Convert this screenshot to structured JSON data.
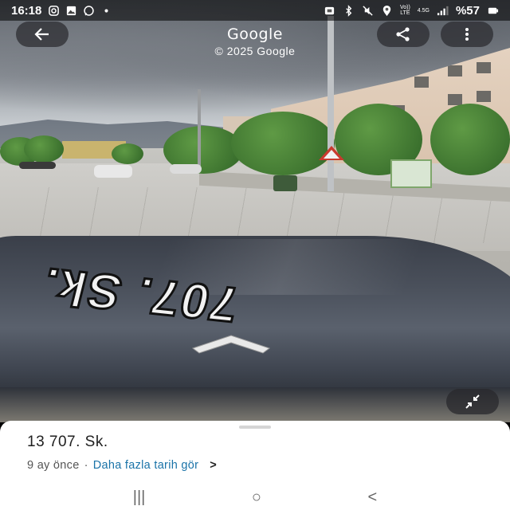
{
  "status_bar": {
    "time": "16:18",
    "network_label_1": "Vo))",
    "network_label_2": "LTE",
    "network_type": "4.5G",
    "battery": "%57"
  },
  "header": {
    "title": "Google",
    "subtitle": "© 2025 Google"
  },
  "scene": {
    "hood_decal": "707. Sk."
  },
  "sheet": {
    "place_name": "13 707. Sk.",
    "date_text": "9 ay önce",
    "separator": "·",
    "history_link": "Daha fazla tarih gör",
    "chevron": ">"
  },
  "system_nav": {
    "recents": "|||",
    "home": "○",
    "back": "<"
  }
}
